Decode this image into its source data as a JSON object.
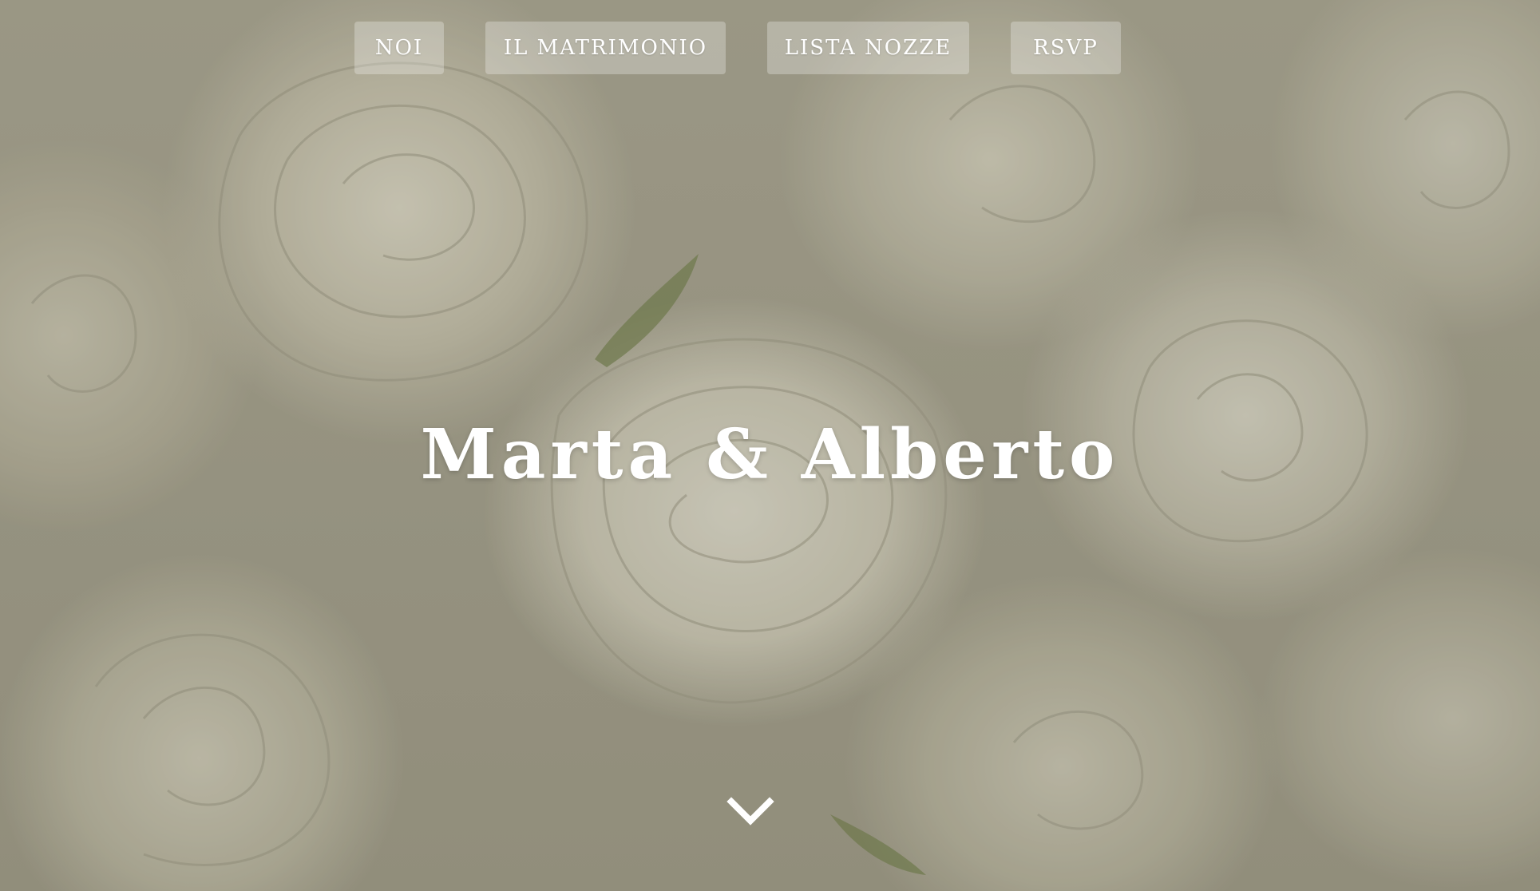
{
  "nav": {
    "items": [
      {
        "label": "NOI"
      },
      {
        "label": "IL MATRIMONIO"
      },
      {
        "label": "LISTA NOZZE"
      },
      {
        "label": "RSVP"
      }
    ]
  },
  "hero": {
    "title": "Marta & Alberto",
    "background": "white roses",
    "scroll_icon": "chevron-down-icon"
  },
  "colors": {
    "text": "#ffffff",
    "nav_button_bg": "rgba(255,255,255,0.28)"
  }
}
